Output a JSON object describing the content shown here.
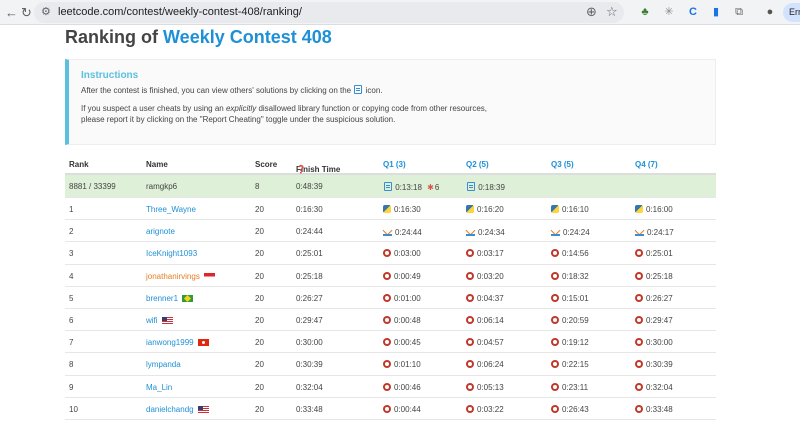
{
  "browser": {
    "url": "leetcode.com/contest/weekly-contest-408/ranking/",
    "profile_label": "Err"
  },
  "page": {
    "title_prefix": "Ranking of",
    "contest_name": "Weekly Contest 408"
  },
  "instructions": {
    "heading": "Instructions",
    "line1_before": "After the contest is finished, you can view others' solutions by clicking on the",
    "line1_after": "icon.",
    "line2_a": "If you suspect a user cheats by using an",
    "line2_em": "explicitly",
    "line2_b": "disallowed library function or copying code from other resources,",
    "line3": "please report it by clicking on the \"Report Cheating\" toggle under the suspicious solution."
  },
  "table": {
    "headers": {
      "rank": "Rank",
      "name": "Name",
      "score": "Score",
      "finish": "Finish Time",
      "q1": "Q1 (3)",
      "q2": "Q2 (5)",
      "q3": "Q3 (5)",
      "q4": "Q4 (7)"
    },
    "me": {
      "rank": "8881 / 33399",
      "name": "ramgkp6",
      "score": "8",
      "finish": "0:48:39",
      "q1": "0:13:18",
      "q1_penalty": "6",
      "q2": "0:18:39"
    },
    "rows": [
      {
        "rank": "1",
        "name": "Three_Wayne",
        "score": "20",
        "finish": "0:16:30",
        "lang": "py",
        "q1": "0:16:30",
        "q2": "0:16:20",
        "q3": "0:16:10",
        "q4": "0:16:00"
      },
      {
        "rank": "2",
        "name": "arignote",
        "score": "20",
        "finish": "0:24:44",
        "lang": "rs",
        "q1": "0:24:44",
        "q2": "0:24:34",
        "q3": "0:24:24",
        "q4": "0:24:17"
      },
      {
        "rank": "3",
        "name": "IceKnight1093",
        "score": "20",
        "finish": "0:25:01",
        "lang": "cpp",
        "q1": "0:03:00",
        "q2": "0:03:17",
        "q3": "0:14:56",
        "q4": "0:25:01"
      },
      {
        "rank": "4",
        "name": "jonathanirvings",
        "score": "20",
        "finish": "0:25:18",
        "lang": "cpp",
        "q1": "0:00:49",
        "q2": "0:03:20",
        "q3": "0:18:32",
        "q4": "0:25:18"
      },
      {
        "rank": "5",
        "name": "brenner1",
        "score": "20",
        "finish": "0:26:27",
        "lang": "cpp",
        "q1": "0:01:00",
        "q2": "0:04:37",
        "q3": "0:15:01",
        "q4": "0:26:27"
      },
      {
        "rank": "6",
        "name": "wifi",
        "score": "20",
        "finish": "0:29:47",
        "lang": "cpp",
        "q1": "0:00:48",
        "q2": "0:06:14",
        "q3": "0:20:59",
        "q4": "0:29:47"
      },
      {
        "rank": "7",
        "name": "ianwong1999",
        "score": "20",
        "finish": "0:30:00",
        "lang": "cpp",
        "q1": "0:00:45",
        "q2": "0:04:57",
        "q3": "0:19:12",
        "q4": "0:30:00"
      },
      {
        "rank": "8",
        "name": "lympanda",
        "score": "20",
        "finish": "0:30:39",
        "lang": "cpp",
        "q1": "0:01:10",
        "q2": "0:06:24",
        "q3": "0:22:15",
        "q4": "0:30:39"
      },
      {
        "rank": "9",
        "name": "Ma_Lin",
        "score": "20",
        "finish": "0:32:04",
        "lang": "cpp",
        "q1": "0:00:46",
        "q2": "0:05:13",
        "q3": "0:23:11",
        "q4": "0:32:04"
      },
      {
        "rank": "10",
        "name": "danielchandg",
        "score": "20",
        "finish": "0:33:48",
        "lang": "cpp",
        "q1": "0:00:44",
        "q2": "0:03:22",
        "q3": "0:26:43",
        "q4": "0:33:48"
      }
    ]
  }
}
